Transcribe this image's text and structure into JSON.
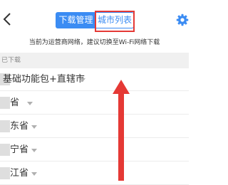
{
  "header": {
    "tabs": [
      {
        "label": "下载管理",
        "active": true
      },
      {
        "label": "城市列表",
        "active": false
      }
    ],
    "back_icon": "chevron-left-icon",
    "settings_icon": "gear-icon"
  },
  "notice": "当前为运营商网络，建议切换至Wi-Fi网络下载",
  "section": {
    "label": "已下载"
  },
  "items": [
    {
      "label": "基础功能包+直辖市"
    },
    {
      "label": "省"
    },
    {
      "label": "东省"
    },
    {
      "label": "宁省"
    },
    {
      "label": "江省"
    }
  ],
  "colors": {
    "accent": "#3b8cf3",
    "annotation_red": "#e53935"
  }
}
